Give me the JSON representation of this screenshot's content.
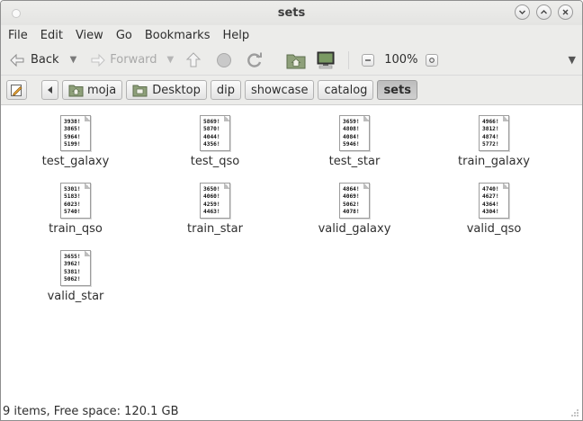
{
  "window": {
    "title": "sets"
  },
  "menu": [
    "File",
    "Edit",
    "View",
    "Go",
    "Bookmarks",
    "Help"
  ],
  "toolbar": {
    "back_label": "Back",
    "forward_label": "Forward",
    "zoom_level": "100%"
  },
  "path": [
    "moja",
    "Desktop",
    "dip",
    "showcase",
    "catalog",
    "sets"
  ],
  "files": [
    {
      "name": "test_galaxy",
      "preview": [
        "3938!",
        "3865!",
        "5964!",
        "5199!"
      ]
    },
    {
      "name": "test_qso",
      "preview": [
        "5869!",
        "5870!",
        "4044!",
        "4356!"
      ]
    },
    {
      "name": "test_star",
      "preview": [
        "3659!",
        "4808!",
        "4084!",
        "5946!"
      ]
    },
    {
      "name": "train_galaxy",
      "preview": [
        "4966!",
        "3812!",
        "4874!",
        "5772!"
      ]
    },
    {
      "name": "train_qso",
      "preview": [
        "5301!",
        "5183!",
        "6023!",
        "5740!"
      ]
    },
    {
      "name": "train_star",
      "preview": [
        "3650!",
        "4060!",
        "4259!",
        "4463!"
      ]
    },
    {
      "name": "valid_galaxy",
      "preview": [
        "4864!",
        "4069!",
        "5062!",
        "4078!"
      ]
    },
    {
      "name": "valid_qso",
      "preview": [
        "4740!",
        "4627!",
        "4364!",
        "4304!"
      ]
    },
    {
      "name": "valid_star",
      "preview": [
        "3655!",
        "3962!",
        "5381!",
        "5062!"
      ]
    }
  ],
  "status": {
    "text": "9 items, Free space: 120.1 GB"
  }
}
